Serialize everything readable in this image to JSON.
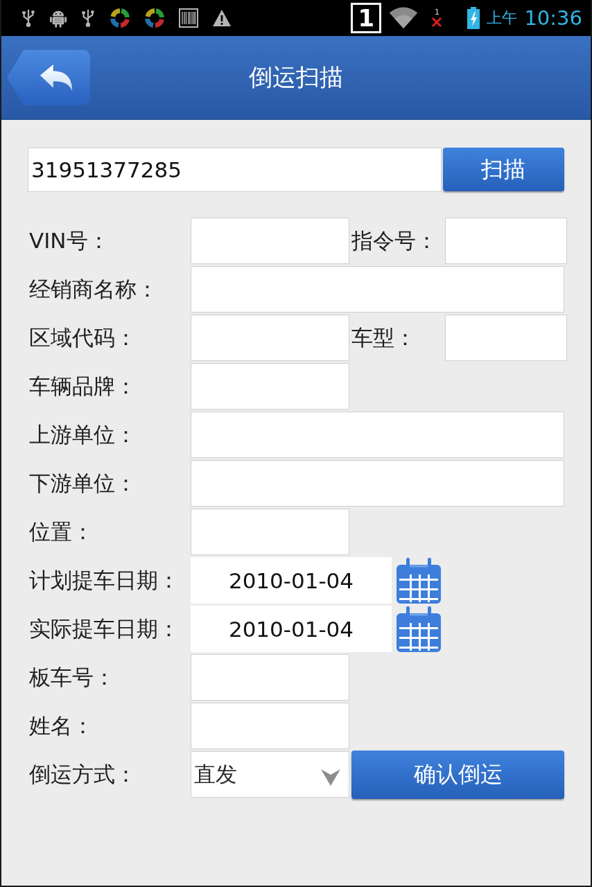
{
  "status_bar": {
    "notification_count": "1",
    "sim_label": "1",
    "time_prefix": "上午",
    "time": "10:36"
  },
  "header": {
    "title": "倒运扫描"
  },
  "scan": {
    "value": "31951377285",
    "button": "扫描"
  },
  "form": {
    "rows": [
      {
        "label": "VIN号：",
        "kind": "pair",
        "second_label": "指令号："
      },
      {
        "label": "经销商名称：",
        "kind": "wide"
      },
      {
        "label": "区域代码：",
        "kind": "pair",
        "second_label": "车型："
      },
      {
        "label": "车辆品牌：",
        "kind": "short"
      },
      {
        "label": "上游单位：",
        "kind": "wide"
      },
      {
        "label": "下游单位：",
        "kind": "wide"
      },
      {
        "label": "位置：",
        "kind": "short"
      },
      {
        "label": "计划提车日期：",
        "kind": "date",
        "value": "2010-01-04"
      },
      {
        "label": "实际提车日期：",
        "kind": "date",
        "value": "2010-01-04"
      },
      {
        "label": "板车号：",
        "kind": "short"
      },
      {
        "label": "姓名：",
        "kind": "short"
      },
      {
        "label": "倒运方式：",
        "kind": "select",
        "value": "直发",
        "button": "确认倒运"
      }
    ]
  }
}
